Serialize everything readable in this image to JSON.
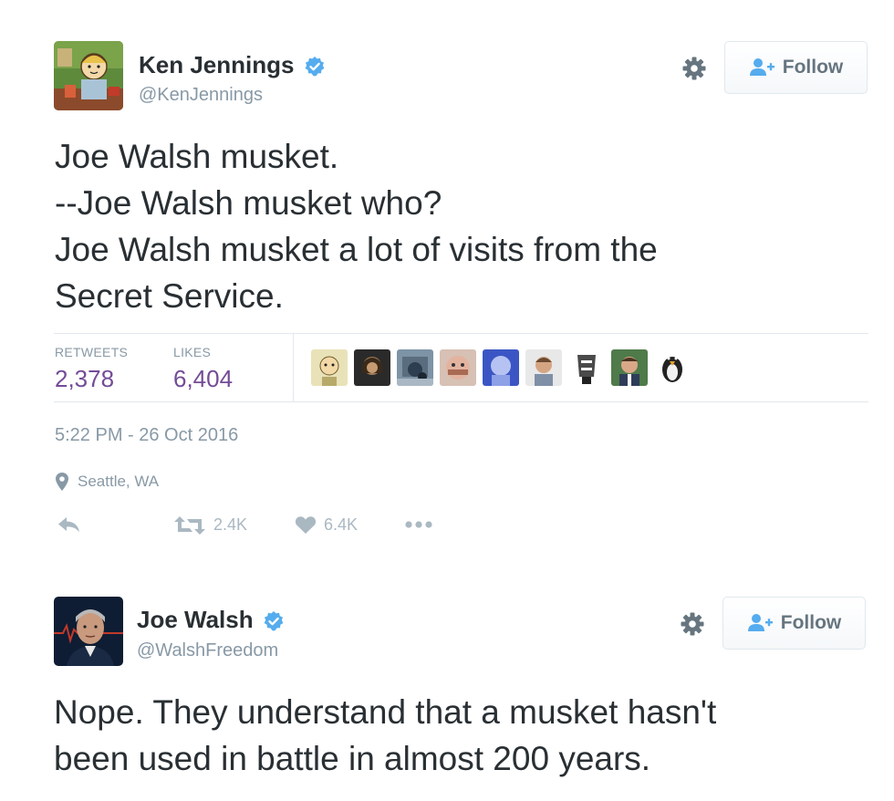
{
  "tweet1": {
    "author_name": "Ken Jennings",
    "handle": "@KenJennings",
    "follow_label": "Follow",
    "text_lines": [
      "Joe Walsh musket.",
      "--Joe Walsh musket who?",
      "Joe Walsh musket a lot of visits from the",
      "Secret Service."
    ],
    "stats": {
      "retweets_label": "RETWEETS",
      "retweets_value": "2,378",
      "likes_label": "LIKES",
      "likes_value": "6,404"
    },
    "timestamp": "5:22 PM - 26 Oct 2016",
    "location": "Seattle, WA",
    "actions": {
      "retweet_count": "2.4K",
      "like_count": "6.4K"
    },
    "icons": [
      "verified-badge-icon",
      "gear-icon",
      "follow-person-icon",
      "location-pin-icon",
      "reply-icon",
      "retweet-icon",
      "heart-icon",
      "more-dots-icon"
    ]
  },
  "tweet2": {
    "author_name": "Joe Walsh",
    "handle": "@WalshFreedom",
    "follow_label": "Follow",
    "text_lines": [
      "Nope. They understand that a musket hasn't",
      "been used in battle in almost 200 years."
    ]
  },
  "colors": {
    "verified": "#55acee",
    "stat_value": "#744c96",
    "muted": "#8899a6",
    "text": "#292f33",
    "divider": "#e1e8ed"
  }
}
